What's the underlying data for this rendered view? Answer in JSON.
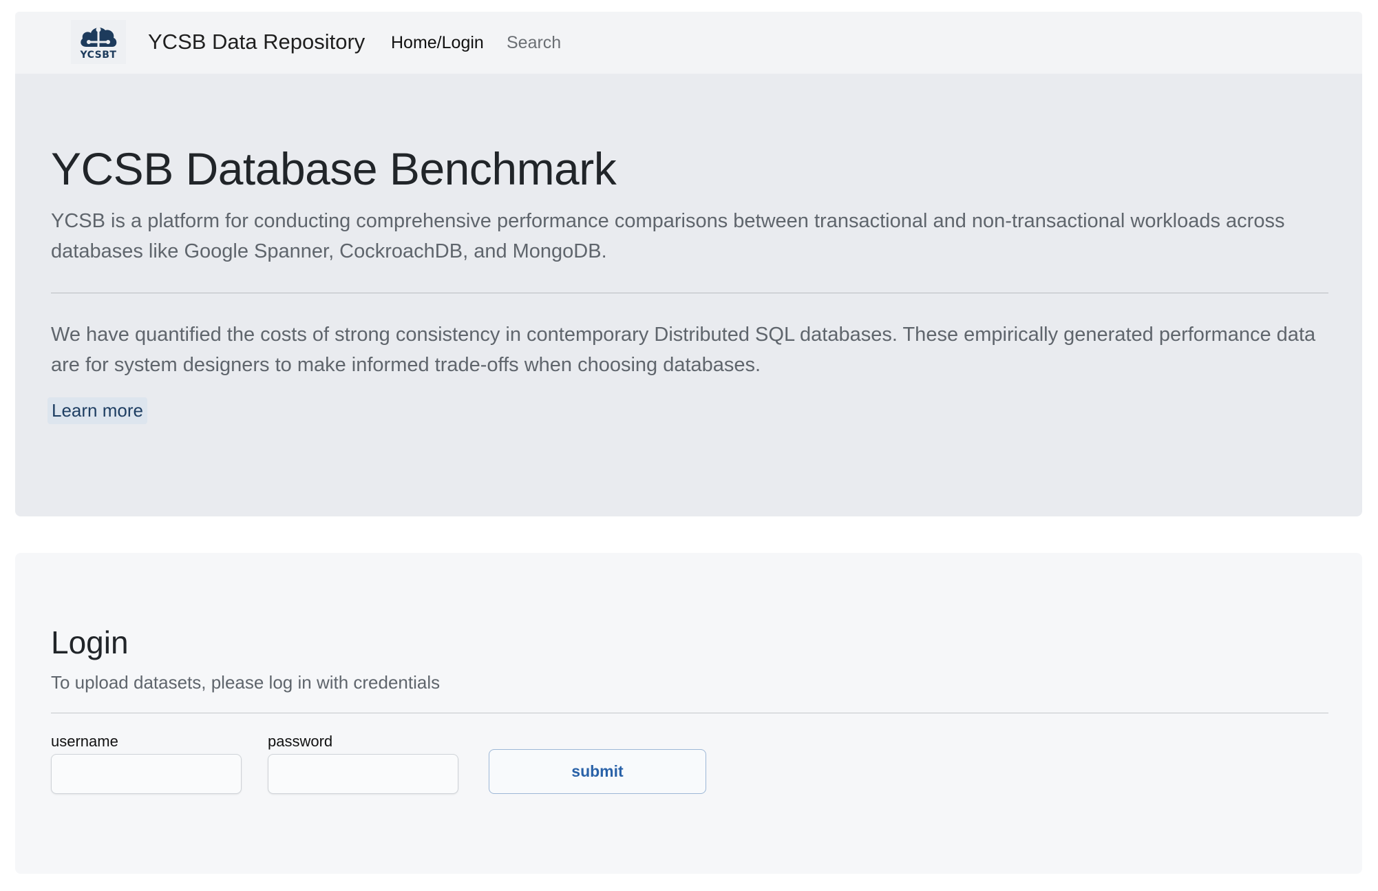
{
  "navbar": {
    "logo_text": "YCSBT",
    "brand": "YCSB Data Repository",
    "links": [
      {
        "label": "Home/Login"
      },
      {
        "label": "Search"
      }
    ]
  },
  "hero": {
    "title": "YCSB Database Benchmark",
    "lead": "YCSB is a platform for conducting comprehensive performance comparisons between transactional and non-transactional workloads across databases like Google Spanner, CockroachDB, and MongoDB.",
    "body": "We have quantified the costs of strong consistency in contemporary Distributed SQL databases. These empirically generated performance data are for system designers to make informed trade-offs when choosing databases.",
    "learn_more": "Learn more"
  },
  "login": {
    "title": "Login",
    "subtitle": "To upload datasets, please log in with credentials",
    "username_label": "username",
    "username_value": "",
    "password_label": "password",
    "password_value": "",
    "submit_label": "submit"
  },
  "colors": {
    "navbar_bg": "#f3f4f6",
    "hero_bg": "#e9ebef",
    "login_bg": "#f6f7f9",
    "accent": "#2a62a8",
    "logo_blue": "#1d3b5c"
  }
}
